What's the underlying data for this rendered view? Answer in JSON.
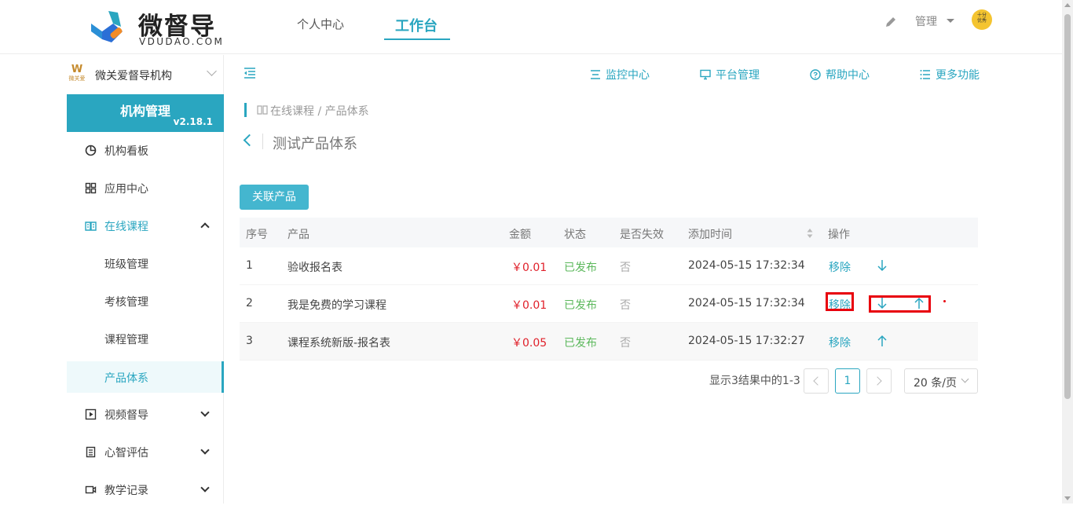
{
  "brand": {
    "name": "微督导",
    "domain": "VDUDAO.COM",
    "accent_color": "#2aa6c0"
  },
  "top_nav": {
    "tabs": [
      {
        "label": "个人中心",
        "active": false
      },
      {
        "label": "工作台",
        "active": true
      }
    ],
    "admin_label": "管理",
    "avatar_text_line1": "十分",
    "avatar_text_line2": "优秀"
  },
  "sidebar": {
    "org_logo_text": "微关爱",
    "org_name": "微关爱督导机构",
    "org_card_title": "机构管理",
    "version": "v2.18.1",
    "items": [
      {
        "label": "机构看板",
        "icon": "pie-chart-icon"
      },
      {
        "label": "应用中心",
        "icon": "grid-icon"
      },
      {
        "label": "在线课程",
        "icon": "book-icon",
        "expanded": true
      },
      {
        "label": "视频督导",
        "icon": "video-play-icon"
      },
      {
        "label": "心智评估",
        "icon": "notebook-icon"
      },
      {
        "label": "教学记录",
        "icon": "camera-icon"
      }
    ],
    "sub_items": [
      {
        "label": "班级管理"
      },
      {
        "label": "考核管理"
      },
      {
        "label": "课程管理"
      },
      {
        "label": "产品体系",
        "selected": true
      }
    ]
  },
  "toolbar": {
    "links": [
      {
        "label": "监控中心",
        "icon": "monitor-list-icon"
      },
      {
        "label": "平台管理",
        "icon": "desktop-icon"
      },
      {
        "label": "帮助中心",
        "icon": "help-circle-icon"
      },
      {
        "label": "更多功能",
        "icon": "list-icon"
      }
    ]
  },
  "breadcrumb": "在线课程 / 产品体系",
  "page_title": "测试产品体系",
  "actions": {
    "link_product": "关联产品"
  },
  "table": {
    "headers": [
      "序号",
      "产品",
      "金额",
      "状态",
      "是否失效",
      "添加时间",
      "操作"
    ],
    "rows": [
      {
        "index": "1",
        "product": "验收报名表",
        "amount": "￥0.01",
        "status": "已发布",
        "expired": "否",
        "added": "2024-05-15 17:32:34",
        "action": "移除",
        "down": true,
        "up": false
      },
      {
        "index": "2",
        "product": "我是免费的学习课程",
        "amount": "￥0.01",
        "status": "已发布",
        "expired": "否",
        "added": "2024-05-15 17:32:34",
        "action": "移除",
        "down": true,
        "up": true
      },
      {
        "index": "3",
        "product": "课程系统新版-报名表",
        "amount": "￥0.05",
        "status": "已发布",
        "expired": "否",
        "added": "2024-05-15 17:32:27",
        "action": "移除",
        "down": false,
        "up": true
      }
    ]
  },
  "pagination": {
    "summary": "显示3结果中的1-3",
    "current_page": "1",
    "page_size": "20 条/页"
  }
}
